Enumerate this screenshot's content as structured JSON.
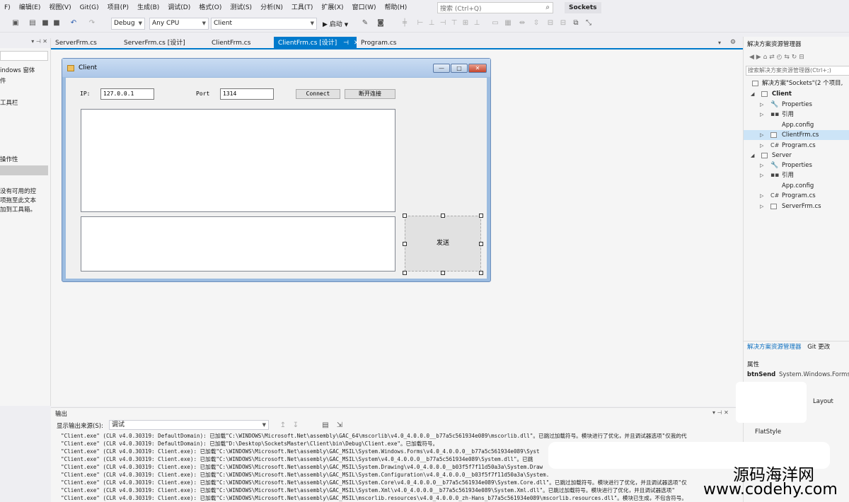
{
  "menu": {
    "items": [
      "F)",
      "编辑(E)",
      "视图(V)",
      "Git(G)",
      "项目(P)",
      "生成(B)",
      "调试(D)",
      "格式(O)",
      "测试(S)",
      "分析(N)",
      "工具(T)",
      "扩展(X)",
      "窗口(W)",
      "帮助(H)"
    ],
    "search_placeholder": "搜索 (Ctrl+Q)",
    "solution_badge": "Sockets"
  },
  "toolbar": {
    "config": "Debug",
    "platform": "Any CPU",
    "startup_project": "Client",
    "start_label": "启动"
  },
  "left_panel": {
    "lines": [
      "indows 窗体",
      "件",
      "工具栏",
      "操作性",
      "没有可用的控",
      "项拖至此文本",
      "加到工具箱。"
    ]
  },
  "tabs": [
    {
      "label": "ServerFrm.cs"
    },
    {
      "label": "ServerFrm.cs [设计]"
    },
    {
      "label": "ClientFrm.cs"
    },
    {
      "label": "ClientFrm.cs [设计]"
    },
    {
      "label": "Program.cs"
    }
  ],
  "form": {
    "title": "Client",
    "ip_label": "IP:",
    "ip_value": "127.0.0.1",
    "port_label": "Port",
    "port_value": "1314",
    "connect_label": "Connect",
    "disconnect_label": "断开连接",
    "send_label": "发送",
    "min_glyph": "—",
    "max_glyph": "□",
    "close_glyph": "✕"
  },
  "solution_explorer": {
    "title": "解决方案资源管理器",
    "search_placeholder": "搜索解决方案资源管理器(Ctrl+;)",
    "solution_label": "解决方案\"Sockets\"(2 个项目,",
    "rows": [
      {
        "label": "Client",
        "bold": true
      },
      {
        "label": "Properties"
      },
      {
        "label": "引用"
      },
      {
        "label": "App.config"
      },
      {
        "label": "ClientFrm.cs",
        "selected": true
      },
      {
        "label": "Program.cs"
      },
      {
        "label": "Server"
      },
      {
        "label": "Properties"
      },
      {
        "label": "引用"
      },
      {
        "label": "App.config"
      },
      {
        "label": "Program.cs"
      },
      {
        "label": "ServerFrm.cs"
      }
    ],
    "tab_solution": "解决方案资源管理器",
    "tab_git": "Git 更改"
  },
  "properties": {
    "title": "属性",
    "object_name": "btnSend",
    "object_type": "System.Windows.Forms",
    "prop1": "Layout",
    "prop2": "FlatStyle"
  },
  "output": {
    "title": "输出",
    "source_label": "显示输出来源(S):",
    "source_value": "调试",
    "lines": [
      "\"Client.exe\" (CLR v4.0.30319: DefaultDomain): 已加载\"C:\\WINDOWS\\Microsoft.Net\\assembly\\GAC_64\\mscorlib\\v4.0_4.0.0.0__b77a5c561934e089\\mscorlib.dll\"。已跳过加载符号。模块进行了优化，并且调试器选项\"仅我的代",
      "\"Client.exe\" (CLR v4.0.30319: DefaultDomain): 已加载\"D:\\Desktop\\SocketsMaster\\Client\\bin\\Debug\\Client.exe\"。已加载符号。",
      "\"Client.exe\" (CLR v4.0.30319: Client.exe): 已加载\"C:\\WINDOWS\\Microsoft.Net\\assembly\\GAC_MSIL\\System.Windows.Forms\\v4.0_4.0.0.0__b77a5c561934e089\\Syst",
      "\"Client.exe\" (CLR v4.0.30319: Client.exe): 已加载\"C:\\WINDOWS\\Microsoft.Net\\assembly\\GAC_MSIL\\System\\v4.0_4.0.0.0__b77a5c561934e089\\System.dll\"。已跳",
      "\"Client.exe\" (CLR v4.0.30319: Client.exe): 已加载\"C:\\WINDOWS\\Microsoft.Net\\assembly\\GAC_MSIL\\System.Drawing\\v4.0_4.0.0.0__b03f5f7f11d50a3a\\System.Draw",
      "\"Client.exe\" (CLR v4.0.30319: Client.exe): 已加载\"C:\\WINDOWS\\Microsoft.Net\\assembly\\GAC_MSIL\\System.Configuration\\v4.0_4.0.0.0__b03f5f7f11d50a3a\\System.",
      "\"Client.exe\" (CLR v4.0.30319: Client.exe): 已加载\"C:\\WINDOWS\\Microsoft.Net\\assembly\\GAC_MSIL\\System.Core\\v4.0_4.0.0.0__b77a5c561934e089\\System.Core.dll\"。已跳过加载符号。模块进行了优化，并且调试器选项\"仅",
      "\"Client.exe\" (CLR v4.0.30319: Client.exe): 已加载\"C:\\WINDOWS\\Microsoft.Net\\assembly\\GAC_MSIL\\System.Xml\\v4.0_4.0.0.0__b77a5c561934e089\\System.Xml.dll\"。已跳过加载符号。模块进行了优化，并且调试器选项\"",
      "\"Client.exe\" (CLR v4.0.30319: Client.exe): 已加载\"C:\\WINDOWS\\Microsoft.Net\\assembly\\GAC_MSIL\\mscorlib.resources\\v4.0_4.0.0.0_zh-Hans_b77a5c561934e089\\mscorlib.resources.dll\"。模块已生成，不包含符号。"
    ]
  },
  "watermark": {
    "line1": "源码海洋网",
    "line2": "www.codehy.com"
  }
}
